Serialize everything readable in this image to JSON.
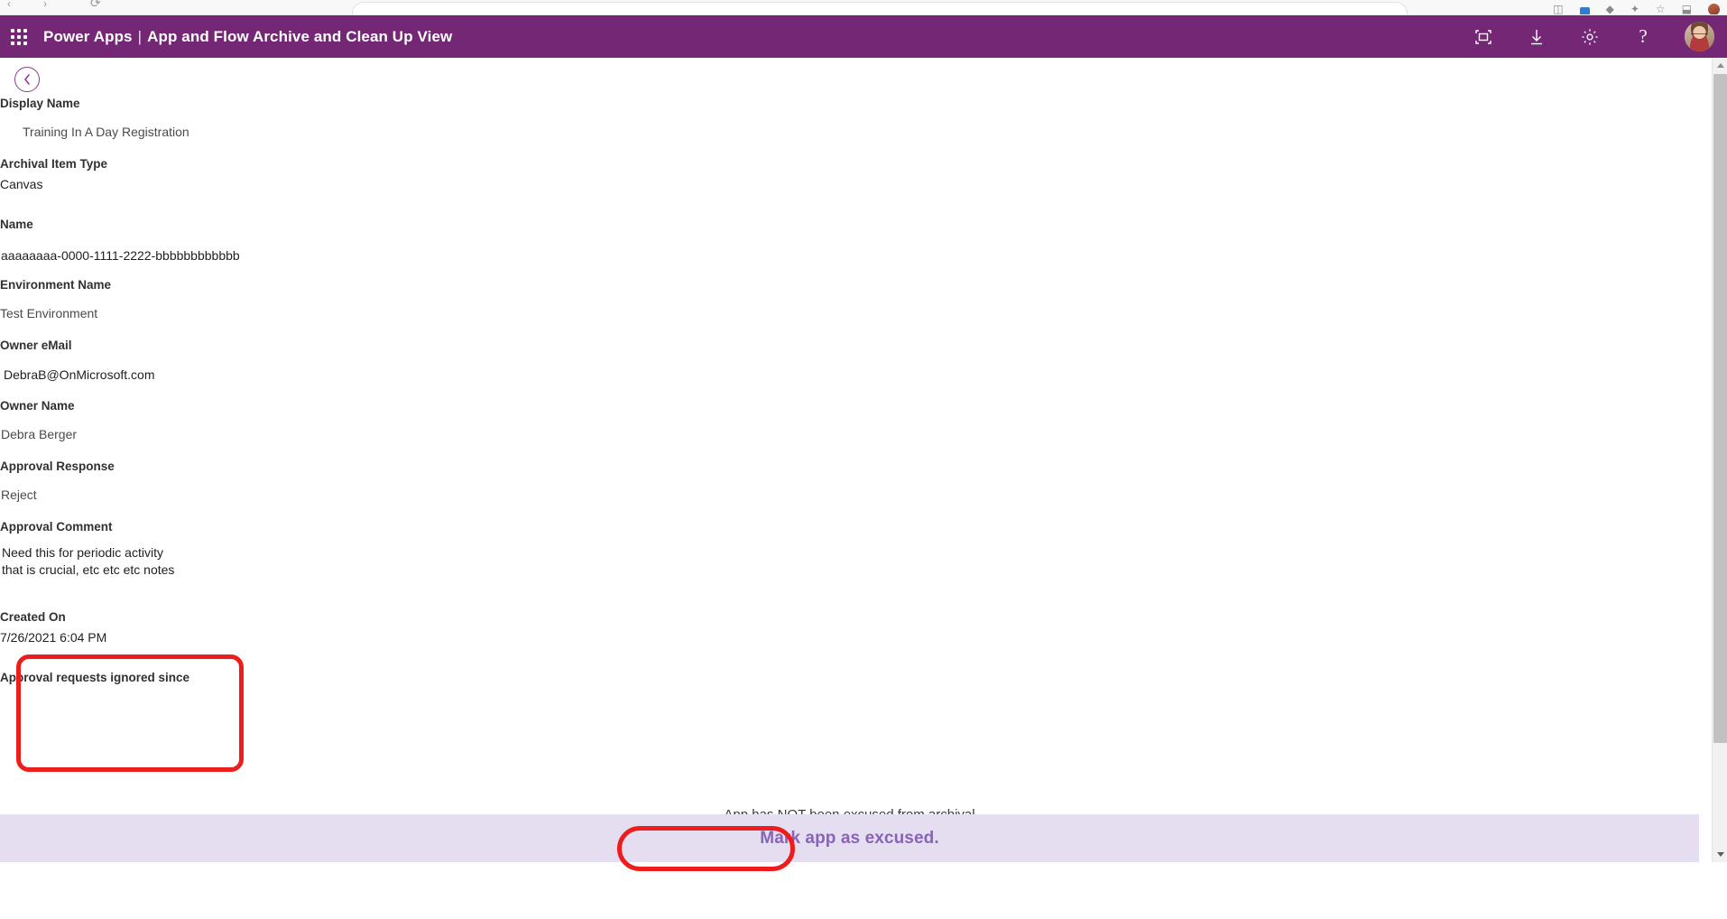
{
  "browser": {
    "omnibox_text": "",
    "icons": [
      "back-arrow",
      "forward-arrow",
      "reload",
      "bookmark",
      "extensions",
      "profile"
    ]
  },
  "header": {
    "waffle_label": "App launcher",
    "brand": "Power Apps",
    "separator": "|",
    "app_title": "App and Flow Archive and Clean Up View",
    "actions": [
      {
        "name": "fit-to-screen-icon",
        "label": "Fit to screen"
      },
      {
        "name": "download-icon",
        "label": "Download"
      },
      {
        "name": "settings-gear-icon",
        "label": "Settings"
      },
      {
        "name": "help-icon",
        "label": "?"
      }
    ],
    "avatar_label": "Account manager"
  },
  "screen": {
    "back_label": "Back",
    "fields": [
      {
        "label": "Display Name",
        "value": "Training In A Day Registration"
      },
      {
        "label": "Archival Item Type",
        "value": "Canvas"
      },
      {
        "label": "Name",
        "value": "aaaaaaaa-0000-1111-2222-bbbbbbbbbbbb"
      },
      {
        "label": "Environment Name",
        "value": "Test Environment"
      },
      {
        "label": "Owner eMail",
        "value": "DebraB@OnMicrosoft.com"
      },
      {
        "label": "Owner Name",
        "value": "Debra Berger"
      },
      {
        "label": "Approval Response",
        "value": "Reject"
      },
      {
        "label": "Approval Comment",
        "value": "Need this for periodic activity that is crucial, etc etc etc notes"
      },
      {
        "label": "Created On",
        "value": "7/26/2021 6:04 PM"
      },
      {
        "label": "Approval requests ignored since",
        "value": ""
      }
    ],
    "status_text": "App has NOT been excused from archival",
    "excuse_button_label": "Mark app as excused."
  },
  "annotations": [
    {
      "name": "approval-comment-highlight",
      "color": "#ee1d1d"
    },
    {
      "name": "excuse-button-highlight",
      "color": "#ee1d1d"
    }
  ],
  "colors": {
    "brand_purple": "#742774",
    "action_bar": "#e4def0",
    "button_text": "#8764b8",
    "annotation_red": "#ee1d1d"
  }
}
